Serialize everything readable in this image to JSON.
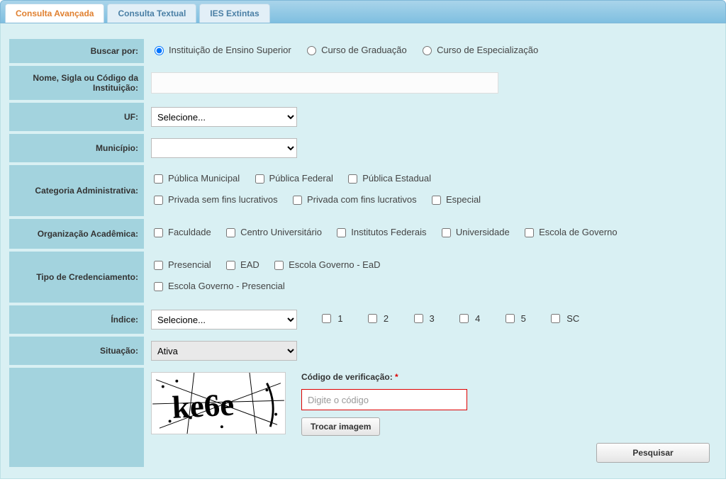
{
  "tabs": {
    "advanced": "Consulta Avançada",
    "textual": "Consulta Textual",
    "extinct": "IES Extintas"
  },
  "labels": {
    "buscar_por": "Buscar por:",
    "nome": "Nome, Sigla ou Código da Instituição:",
    "uf": "UF:",
    "municipio": "Município:",
    "categoria": "Categoria Administrativa:",
    "organizacao": "Organização Acadêmica:",
    "credenciamento": "Tipo de Credenciamento:",
    "indice": "Índice:",
    "situacao": "Situação:"
  },
  "buscar_por_options": {
    "ies": "Instituição de Ensino Superior",
    "grad": "Curso de Graduação",
    "esp": "Curso de Especialização"
  },
  "uf_select": {
    "placeholder": "Selecione..."
  },
  "municipio_select": {
    "placeholder": ""
  },
  "categoria_options": {
    "pub_mun": "Pública Municipal",
    "pub_fed": "Pública Federal",
    "pub_est": "Pública Estadual",
    "priv_sem": "Privada sem fins lucrativos",
    "priv_com": "Privada com fins lucrativos",
    "especial": "Especial"
  },
  "organizacao_options": {
    "faculdade": "Faculdade",
    "centro": "Centro Universitário",
    "institutos": "Institutos Federais",
    "universidade": "Universidade",
    "escola_gov": "Escola de Governo"
  },
  "credenciamento_options": {
    "presencial": "Presencial",
    "ead": "EAD",
    "eg_ead": "Escola Governo - EaD",
    "eg_pres": "Escola Governo - Presencial"
  },
  "indice_select": {
    "placeholder": "Selecione..."
  },
  "indice_options": {
    "i1": "1",
    "i2": "2",
    "i3": "3",
    "i4": "4",
    "i5": "5",
    "sc": "SC"
  },
  "situacao_select": {
    "value": "Ativa"
  },
  "captcha": {
    "label": "Código de verificação:",
    "asterisk": "*",
    "placeholder": "Digite o código",
    "change_button": "Trocar imagem",
    "image_text": "ke6e"
  },
  "search_button": "Pesquisar"
}
